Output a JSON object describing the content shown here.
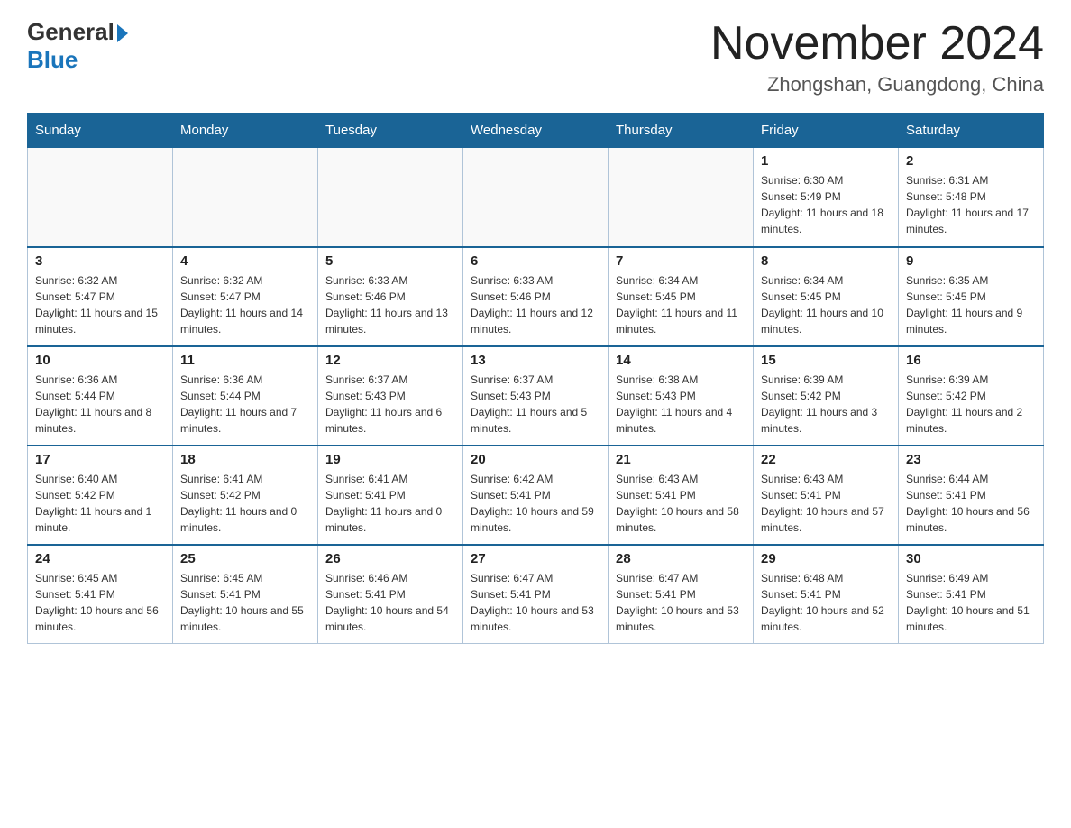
{
  "header": {
    "logo_general": "General",
    "logo_blue": "Blue",
    "month_title": "November 2024",
    "location": "Zhongshan, Guangdong, China"
  },
  "weekdays": [
    "Sunday",
    "Monday",
    "Tuesday",
    "Wednesday",
    "Thursday",
    "Friday",
    "Saturday"
  ],
  "weeks": [
    [
      {
        "day": "",
        "info": ""
      },
      {
        "day": "",
        "info": ""
      },
      {
        "day": "",
        "info": ""
      },
      {
        "day": "",
        "info": ""
      },
      {
        "day": "",
        "info": ""
      },
      {
        "day": "1",
        "info": "Sunrise: 6:30 AM\nSunset: 5:49 PM\nDaylight: 11 hours and 18 minutes."
      },
      {
        "day": "2",
        "info": "Sunrise: 6:31 AM\nSunset: 5:48 PM\nDaylight: 11 hours and 17 minutes."
      }
    ],
    [
      {
        "day": "3",
        "info": "Sunrise: 6:32 AM\nSunset: 5:47 PM\nDaylight: 11 hours and 15 minutes."
      },
      {
        "day": "4",
        "info": "Sunrise: 6:32 AM\nSunset: 5:47 PM\nDaylight: 11 hours and 14 minutes."
      },
      {
        "day": "5",
        "info": "Sunrise: 6:33 AM\nSunset: 5:46 PM\nDaylight: 11 hours and 13 minutes."
      },
      {
        "day": "6",
        "info": "Sunrise: 6:33 AM\nSunset: 5:46 PM\nDaylight: 11 hours and 12 minutes."
      },
      {
        "day": "7",
        "info": "Sunrise: 6:34 AM\nSunset: 5:45 PM\nDaylight: 11 hours and 11 minutes."
      },
      {
        "day": "8",
        "info": "Sunrise: 6:34 AM\nSunset: 5:45 PM\nDaylight: 11 hours and 10 minutes."
      },
      {
        "day": "9",
        "info": "Sunrise: 6:35 AM\nSunset: 5:45 PM\nDaylight: 11 hours and 9 minutes."
      }
    ],
    [
      {
        "day": "10",
        "info": "Sunrise: 6:36 AM\nSunset: 5:44 PM\nDaylight: 11 hours and 8 minutes."
      },
      {
        "day": "11",
        "info": "Sunrise: 6:36 AM\nSunset: 5:44 PM\nDaylight: 11 hours and 7 minutes."
      },
      {
        "day": "12",
        "info": "Sunrise: 6:37 AM\nSunset: 5:43 PM\nDaylight: 11 hours and 6 minutes."
      },
      {
        "day": "13",
        "info": "Sunrise: 6:37 AM\nSunset: 5:43 PM\nDaylight: 11 hours and 5 minutes."
      },
      {
        "day": "14",
        "info": "Sunrise: 6:38 AM\nSunset: 5:43 PM\nDaylight: 11 hours and 4 minutes."
      },
      {
        "day": "15",
        "info": "Sunrise: 6:39 AM\nSunset: 5:42 PM\nDaylight: 11 hours and 3 minutes."
      },
      {
        "day": "16",
        "info": "Sunrise: 6:39 AM\nSunset: 5:42 PM\nDaylight: 11 hours and 2 minutes."
      }
    ],
    [
      {
        "day": "17",
        "info": "Sunrise: 6:40 AM\nSunset: 5:42 PM\nDaylight: 11 hours and 1 minute."
      },
      {
        "day": "18",
        "info": "Sunrise: 6:41 AM\nSunset: 5:42 PM\nDaylight: 11 hours and 0 minutes."
      },
      {
        "day": "19",
        "info": "Sunrise: 6:41 AM\nSunset: 5:41 PM\nDaylight: 11 hours and 0 minutes."
      },
      {
        "day": "20",
        "info": "Sunrise: 6:42 AM\nSunset: 5:41 PM\nDaylight: 10 hours and 59 minutes."
      },
      {
        "day": "21",
        "info": "Sunrise: 6:43 AM\nSunset: 5:41 PM\nDaylight: 10 hours and 58 minutes."
      },
      {
        "day": "22",
        "info": "Sunrise: 6:43 AM\nSunset: 5:41 PM\nDaylight: 10 hours and 57 minutes."
      },
      {
        "day": "23",
        "info": "Sunrise: 6:44 AM\nSunset: 5:41 PM\nDaylight: 10 hours and 56 minutes."
      }
    ],
    [
      {
        "day": "24",
        "info": "Sunrise: 6:45 AM\nSunset: 5:41 PM\nDaylight: 10 hours and 56 minutes."
      },
      {
        "day": "25",
        "info": "Sunrise: 6:45 AM\nSunset: 5:41 PM\nDaylight: 10 hours and 55 minutes."
      },
      {
        "day": "26",
        "info": "Sunrise: 6:46 AM\nSunset: 5:41 PM\nDaylight: 10 hours and 54 minutes."
      },
      {
        "day": "27",
        "info": "Sunrise: 6:47 AM\nSunset: 5:41 PM\nDaylight: 10 hours and 53 minutes."
      },
      {
        "day": "28",
        "info": "Sunrise: 6:47 AM\nSunset: 5:41 PM\nDaylight: 10 hours and 53 minutes."
      },
      {
        "day": "29",
        "info": "Sunrise: 6:48 AM\nSunset: 5:41 PM\nDaylight: 10 hours and 52 minutes."
      },
      {
        "day": "30",
        "info": "Sunrise: 6:49 AM\nSunset: 5:41 PM\nDaylight: 10 hours and 51 minutes."
      }
    ]
  ]
}
